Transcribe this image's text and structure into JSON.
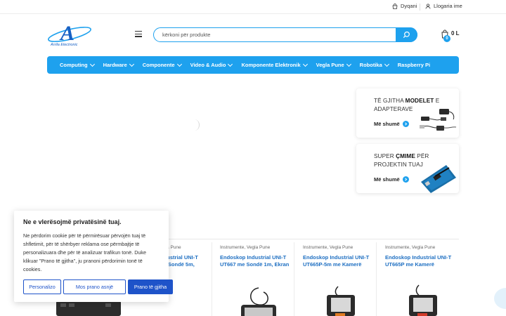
{
  "topbar": {
    "store_label": "Dyqani",
    "account_label": "Llogaria ime"
  },
  "logo": {
    "text": "Arrila Electronic",
    "letter": "A"
  },
  "search": {
    "placeholder": "kërkoni për produkte"
  },
  "cart": {
    "count": "0",
    "total": "0 L"
  },
  "nav": {
    "items": [
      {
        "label": "Computing",
        "has_dropdown": true
      },
      {
        "label": "Hardware",
        "has_dropdown": true
      },
      {
        "label": "Componente",
        "has_dropdown": true
      },
      {
        "label": "Video & Audio",
        "has_dropdown": true
      },
      {
        "label": "Komponente Elektronik",
        "has_dropdown": true
      },
      {
        "label": "Vegla Pune",
        "has_dropdown": true
      },
      {
        "label": "Robotika",
        "has_dropdown": true
      },
      {
        "label": "Raspberry Pi",
        "has_dropdown": false
      }
    ]
  },
  "promos": [
    {
      "line1_pre": "TË GJITHA ",
      "line1_bold": "MODELET",
      "line1_post": " E",
      "line2": "ADAPTERAVE",
      "more": "Më shumë"
    },
    {
      "line1_pre": "SUPER ",
      "line1_bold": "ÇMIME",
      "line1_post": " PËR",
      "line2": "PROJEKTIN TUAJ",
      "more": "Më shumë"
    }
  ],
  "products": [
    {
      "cat": "gla Pune",
      "name_l1": "Industrial UNI-T",
      "name_l2": "me Sondë 5m,"
    },
    {
      "cat": "Instrumente, Vegla Pune",
      "name_l1": "Endoskop Industrial UNI-T",
      "name_l2": "UT667 me Sondë 1m, Ekran"
    },
    {
      "cat": "Instrumente, Vegla Pune",
      "name_l1": "Endoskop Industrial UNI-T",
      "name_l2": "UT665P-5m me Kamerë"
    },
    {
      "cat": "Instrumente, Vegla Pune",
      "name_l1": "Endoskop Industrial UNI-T",
      "name_l2": "UT665P me Kamerë"
    }
  ],
  "cookie": {
    "title": "Ne e vlerësojmë privatësinë tuaj.",
    "body": "Ne përdorim cookie për të përmirësuar përvojën tuaj të shfletimit, për të shërbyer reklama ose përmbajtje të personalizuara dhe për të analizuar trafikun tonë. Duke klikuar \"Prano të gjitha\", ju pranoni përdorimin tonë të cookies.",
    "btn_customize": "Personalizo",
    "btn_reject": "Mos prano asnjë",
    "btn_accept": "Prano të gjitha"
  },
  "colors": {
    "accent": "#1ea1ee",
    "cookie_btn": "#1e53c9",
    "product_title": "#1e6fc2"
  }
}
